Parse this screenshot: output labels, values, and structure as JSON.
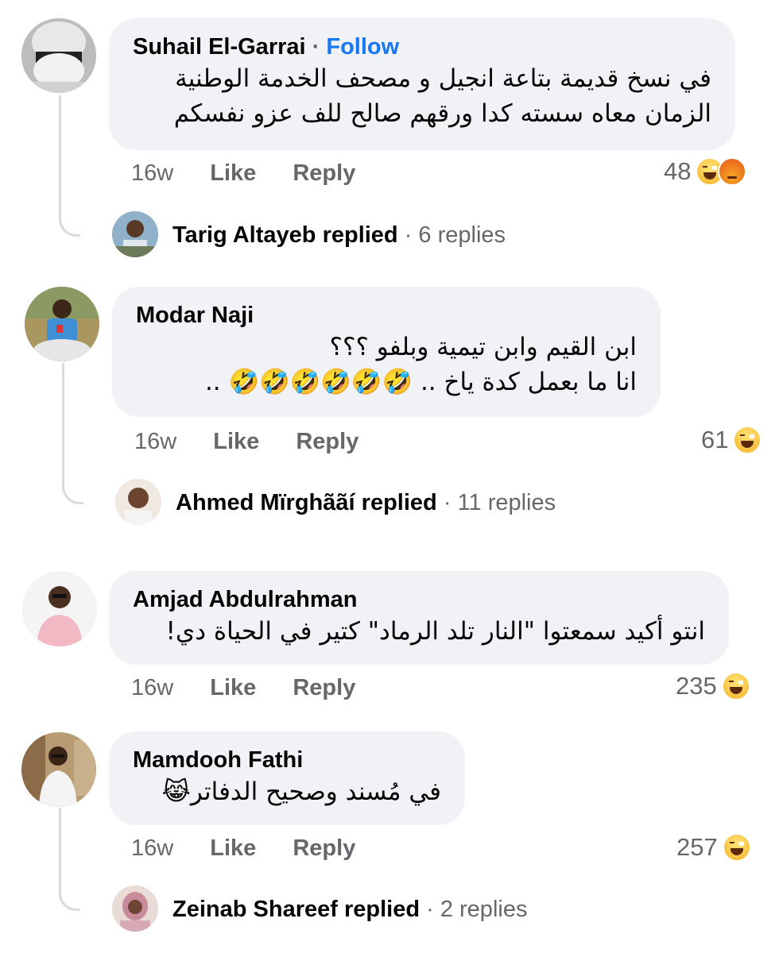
{
  "comments": [
    {
      "author": "Suhail El-Garrai",
      "follow_sep": "·",
      "follow_label": "Follow",
      "lines": [
        "في نسخ قديمة بتاعة انجيل و مصحف الخدمة الوطنية",
        "الزمان معاه سسته كدا ورقهم صالح للف عزو نفسكم"
      ],
      "time": "16w",
      "like": "Like",
      "reply": "Reply",
      "reaction_count": "48",
      "reactions": [
        "haha-icon",
        "angry-icon"
      ],
      "replied_by": "Tarig Altayeb",
      "replied_word": "replied",
      "replies": "· 6 replies"
    },
    {
      "author": "Modar Naji",
      "lines": [
        "ابن القيم وابن تيمية وبلفو ؟؟؟",
        "انا ما بعمل كدة ياخ .. 🤣🤣🤣🤣🤣🤣 .."
      ],
      "time": "16w",
      "like": "Like",
      "reply": "Reply",
      "reaction_count": "61",
      "reactions": [
        "haha-icon"
      ],
      "replied_by": "Ahmed Mïrghããí",
      "replied_word": "replied",
      "replies": "· 11 replies"
    },
    {
      "author": "Amjad Abdulrahman",
      "lines": [
        "انتو أكيد سمعتوا \"النار تلد الرماد\" كتير في الحياة دي!"
      ],
      "time": "16w",
      "like": "Like",
      "reply": "Reply",
      "reaction_count": "235",
      "reactions": [
        "haha-icon"
      ]
    },
    {
      "author": "Mamdooh Fathi",
      "lines": [
        "في مُسند وصحيح الدفاتر😹"
      ],
      "time": "16w",
      "like": "Like",
      "reply": "Reply",
      "reaction_count": "257",
      "reactions": [
        "haha-icon"
      ],
      "replied_by": "Zeinab Shareef",
      "replied_word": "replied",
      "replies": "· 2 replies"
    }
  ],
  "colors": {
    "bubble": "#f0f2f5",
    "link": "#1877f2",
    "meta": "#65676b",
    "thread": "#d8dadf"
  }
}
